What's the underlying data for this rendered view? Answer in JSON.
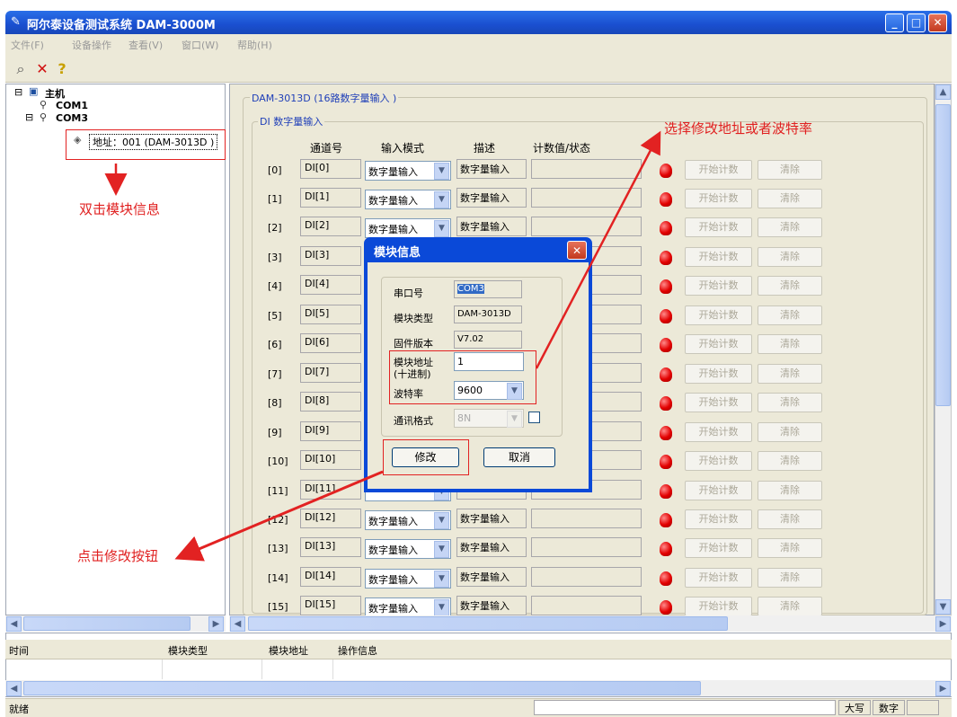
{
  "window": {
    "title": "阿尔泰设备测试系统 DAM-3000M"
  },
  "menu": [
    "文件(F)",
    "设备操作",
    "查看(V)",
    "窗口(W)",
    "帮助(H)"
  ],
  "tree": {
    "root": "主机",
    "com1": "COM1",
    "com3": "COM3",
    "module": "地址：001 (DAM-3013D )"
  },
  "panel": {
    "title": "DAM-3013D (16路数字量输入 )",
    "group": "DI 数字量输入",
    "headers": [
      "通道号",
      "输入模式",
      "描述",
      "计数值/状态"
    ],
    "rows": [
      {
        "idx": "[0]",
        "ch": "DI[0]",
        "mode": "数字量输入",
        "desc": "数字量输入"
      },
      {
        "idx": "[1]",
        "ch": "DI[1]",
        "mode": "数字量输入",
        "desc": "数字量输入"
      },
      {
        "idx": "[2]",
        "ch": "DI[2]",
        "mode": "数字量输入",
        "desc": "数字量输入"
      },
      {
        "idx": "[3]",
        "ch": "DI[3]",
        "mode": "",
        "desc": ""
      },
      {
        "idx": "[4]",
        "ch": "DI[4]",
        "mode": "",
        "desc": ""
      },
      {
        "idx": "[5]",
        "ch": "DI[5]",
        "mode": "",
        "desc": ""
      },
      {
        "idx": "[6]",
        "ch": "DI[6]",
        "mode": "",
        "desc": ""
      },
      {
        "idx": "[7]",
        "ch": "DI[7]",
        "mode": "",
        "desc": ""
      },
      {
        "idx": "[8]",
        "ch": "DI[8]",
        "mode": "",
        "desc": ""
      },
      {
        "idx": "[9]",
        "ch": "DI[9]",
        "mode": "",
        "desc": ""
      },
      {
        "idx": "[10]",
        "ch": "DI[10]",
        "mode": "",
        "desc": ""
      },
      {
        "idx": "[11]",
        "ch": "DI[11]",
        "mode": "",
        "desc": ""
      },
      {
        "idx": "[12]",
        "ch": "DI[12]",
        "mode": "数字量输入",
        "desc": "数字量输入"
      },
      {
        "idx": "[13]",
        "ch": "DI[13]",
        "mode": "数字量输入",
        "desc": "数字量输入"
      },
      {
        "idx": "[14]",
        "ch": "DI[14]",
        "mode": "数字量输入",
        "desc": "数字量输入"
      },
      {
        "idx": "[15]",
        "ch": "DI[15]",
        "mode": "数字量输入",
        "desc": "数字量输入"
      }
    ],
    "start_label": "开始计数",
    "clear_label": "清除"
  },
  "dialog": {
    "title": "模块信息",
    "port_label": "串口号",
    "port_value": "COM3",
    "type_label": "模块类型",
    "type_value": "DAM-3013D",
    "fw_label": "固件版本",
    "fw_value": "V7.02",
    "addr_label1": "模块地址",
    "addr_label2": "(十进制)",
    "addr_value": "1",
    "baud_label": "波特率",
    "baud_value": "9600",
    "fmt_label": "通讯格式",
    "fmt_value": "8N",
    "modify_label": "修改",
    "cancel_label": "取消"
  },
  "log": {
    "headers": [
      "时间",
      "模块类型",
      "模块地址",
      "操作信息"
    ]
  },
  "status": {
    "ready": "就绪",
    "caps": "大写",
    "num": "数字"
  },
  "annotations": {
    "double_click": "双击模块信息",
    "select_modify": "选择修改地址或者波特率",
    "click_modify": "点击修改按钮"
  },
  "colors": {
    "annotation": "#e02020",
    "titlebar": "#1a4fd0"
  }
}
